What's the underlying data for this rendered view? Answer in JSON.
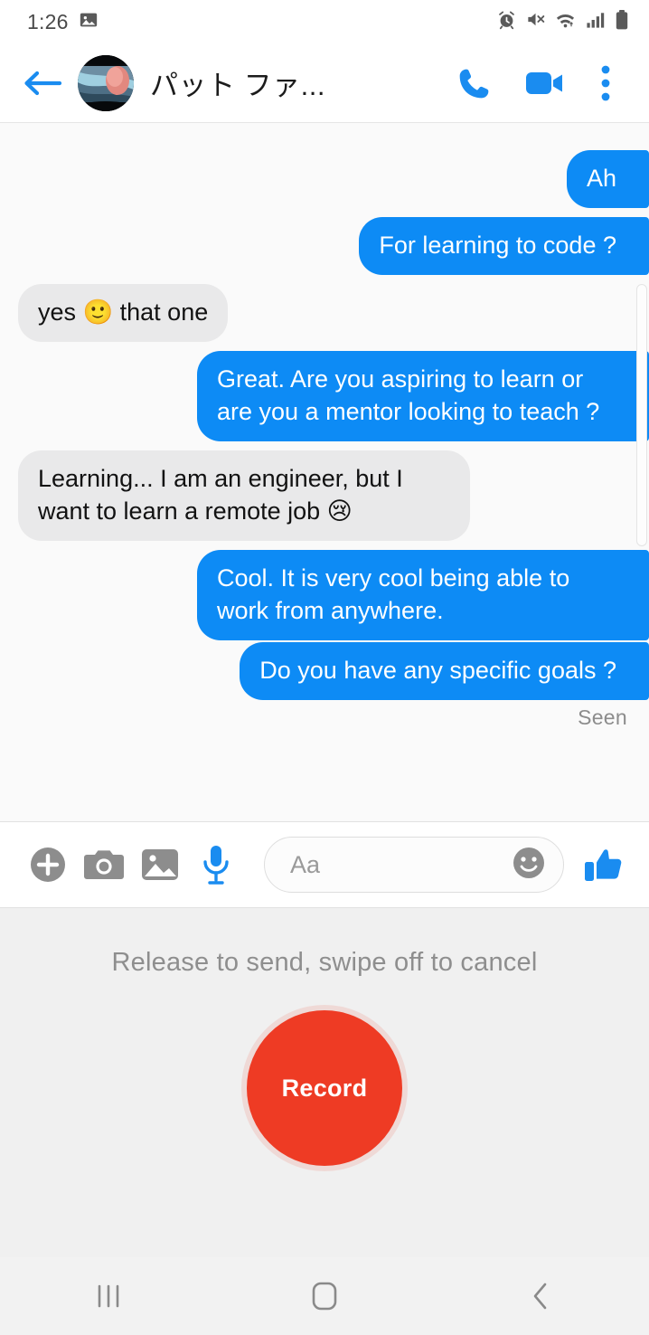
{
  "status_bar": {
    "time": "1:26",
    "left_icons": [
      {
        "name": "image-icon"
      }
    ],
    "right_icons": [
      {
        "name": "alarm-icon"
      },
      {
        "name": "mute-icon"
      },
      {
        "name": "wifi-icon"
      },
      {
        "name": "signal-icon"
      },
      {
        "name": "battery-icon"
      }
    ]
  },
  "header": {
    "back_label": "Back",
    "contact_name": "パット ファ...",
    "actions": [
      {
        "name": "voice-call-icon",
        "label": "Voice call"
      },
      {
        "name": "video-call-icon",
        "label": "Video call"
      },
      {
        "name": "overflow-menu-icon",
        "label": "More options"
      }
    ]
  },
  "conversation": {
    "messages": [
      {
        "side": "out",
        "text": "",
        "clipped": true
      },
      {
        "side": "out",
        "text": "Ah",
        "edge": true
      },
      {
        "side": "out",
        "text": "For learning to code ?",
        "edge": true
      },
      {
        "side": "in",
        "text": "yes 🙂 that one"
      },
      {
        "side": "out",
        "text": "Great. Are you aspiring to learn or are you a mentor looking to teach ?",
        "edge": true
      },
      {
        "side": "in",
        "text": "Learning... I am an engineer, but I want to learn a remote job 😢"
      },
      {
        "side": "out",
        "text": "Cool. It is very cool being able to work from anywhere.",
        "edge": true
      },
      {
        "side": "out",
        "text": "Do you have any specific goals ?",
        "edge": true
      }
    ],
    "receipt": "Seen"
  },
  "composer": {
    "buttons": [
      {
        "name": "add-plus-icon",
        "label": "More actions"
      },
      {
        "name": "camera-icon",
        "label": "Camera"
      },
      {
        "name": "gallery-icon",
        "label": "Gallery"
      },
      {
        "name": "microphone-icon",
        "label": "Voice message"
      }
    ],
    "input_placeholder": "Aa",
    "emoji_button": "emoji-smiley-icon",
    "like_button": "thumbs-up-icon"
  },
  "record_panel": {
    "hint": "Release to send, swipe off to cancel",
    "button_label": "Record",
    "button_color": "#ee3b24"
  },
  "nav_bar": {
    "buttons": [
      {
        "name": "recents-icon",
        "label": "Recents"
      },
      {
        "name": "home-icon",
        "label": "Home"
      },
      {
        "name": "back-nav-icon",
        "label": "Back"
      }
    ]
  },
  "colors": {
    "outgoing_bubble": "#0d8bf5",
    "incoming_bubble": "#e9e9ea",
    "accent_blue": "#1a8cf0",
    "record_red": "#ee3b24",
    "chat_background": "#fafafa"
  }
}
